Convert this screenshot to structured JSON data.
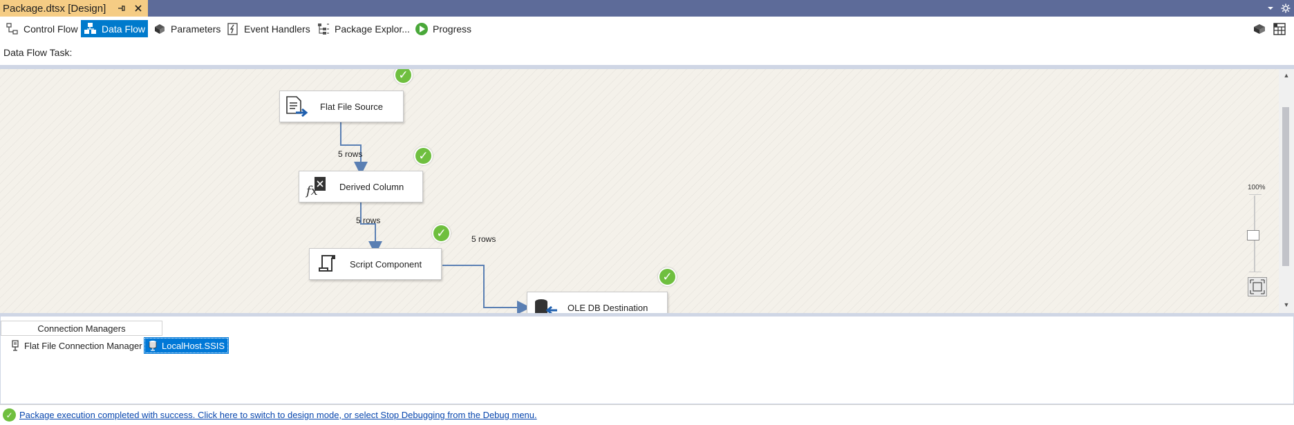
{
  "document_tab": {
    "title": "Package.dtsx [Design]",
    "pin_icon": "pin-icon",
    "close_icon": "close-icon",
    "accent_color": "#f5cc84",
    "strip_color": "#5d6b99"
  },
  "designer_tabs": [
    {
      "label": "Control Flow",
      "icon": "control-flow-icon",
      "active": false
    },
    {
      "label": "Data Flow",
      "icon": "data-flow-icon",
      "active": true
    },
    {
      "label": "Parameters",
      "icon": "parameters-icon",
      "active": false
    },
    {
      "label": "Event Handlers",
      "icon": "event-handlers-icon",
      "active": false
    },
    {
      "label": "Package Explor...",
      "icon": "package-explorer-icon",
      "active": false
    },
    {
      "label": "Progress",
      "icon": "progress-icon",
      "active": false
    }
  ],
  "task_selector": {
    "label": "Data Flow Task:"
  },
  "components": [
    {
      "label": "Flat File Source",
      "icon": "flat-file-source-icon",
      "status": "success"
    },
    {
      "label": "Derived Column",
      "icon": "derived-column-icon",
      "status": "success"
    },
    {
      "label": "Script Component",
      "icon": "script-component-icon",
      "status": "success"
    },
    {
      "label": "OLE DB Destination",
      "icon": "ole-db-destination-icon",
      "status": "success"
    }
  ],
  "paths": [
    {
      "label": "5 rows"
    },
    {
      "label": "5 rows"
    },
    {
      "label": "5 rows"
    }
  ],
  "zoom": {
    "label": "100%",
    "level": 100
  },
  "connection_managers": {
    "header": "Connection Managers",
    "items": [
      {
        "label": "Flat File Connection Manager",
        "selected": false
      },
      {
        "label": "LocalHost.SSIS",
        "selected": true
      }
    ]
  },
  "status_bar": {
    "message": "Package execution completed with success. Click here to switch to design mode, or select Stop Debugging from the Debug menu.",
    "icon": "success-icon"
  },
  "colors": {
    "active_tab": "#007acc",
    "success": "#6fbf3f",
    "link": "#0645ad"
  }
}
